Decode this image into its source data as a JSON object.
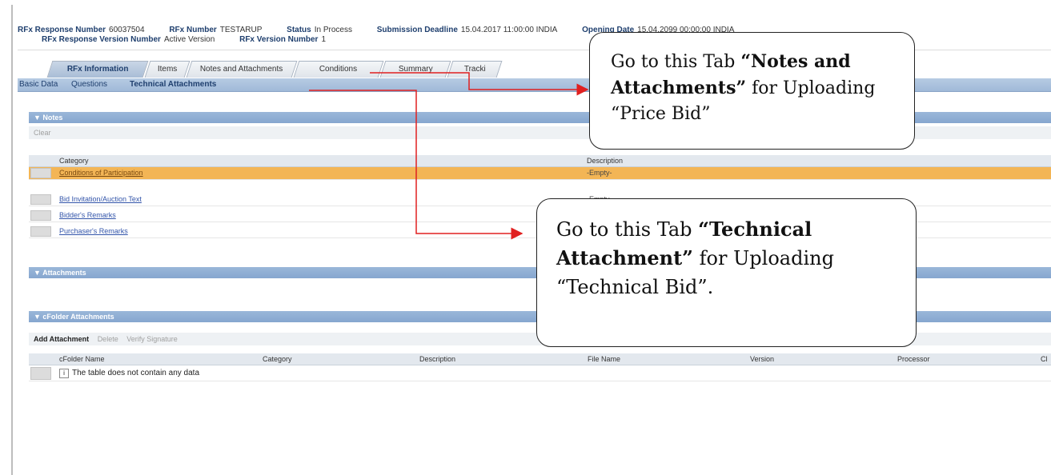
{
  "header": {
    "resp_num_label": "RFx Response Number",
    "resp_num": "60037504",
    "rfx_num_label": "RFx Number",
    "rfx_num": "TESTARUP",
    "status_label": "Status",
    "status": "In Process",
    "deadline_label": "Submission Deadline",
    "deadline": "15.04.2017 11:00:00 INDIA",
    "opening_label": "Opening Date",
    "opening": "15.04.2099 00:00:00 INDIA",
    "resp_ver_label": "RFx Response Version Number",
    "resp_ver": "Active Version",
    "rfx_ver_label": "RFx Version Number",
    "rfx_ver": "1"
  },
  "tabs": [
    "RFx Information",
    "Items",
    "Notes and Attachments",
    "Conditions",
    "Summary",
    "Tracki"
  ],
  "subnav": [
    "Basic Data",
    "Questions",
    "Technical Attachments"
  ],
  "notes": {
    "title": "Notes",
    "clear": "Clear",
    "col_category": "Category",
    "col_description": "Description",
    "rows": [
      {
        "category": "Conditions of Participation",
        "description": "-Empty-"
      },
      {
        "category": "Bid Invitation/Auction Text",
        "description": "-Empty-"
      },
      {
        "category": "Bidder's Remarks",
        "description": ""
      },
      {
        "category": "Purchaser's Remarks",
        "description": ""
      }
    ]
  },
  "attachments": {
    "title": "Attachments"
  },
  "cfolder": {
    "title": "cFolder Attachments",
    "add": "Add Attachment",
    "delete": "Delete",
    "verify": "Verify Signature",
    "columns": [
      "cFolder Name",
      "Category",
      "Description",
      "File Name",
      "Version",
      "Processor",
      "Cl"
    ],
    "empty_text": "The table does not contain any data"
  },
  "callouts": {
    "c1_pre": "Go to this Tab ",
    "c1_bold": "“Notes and Attachments”",
    "c1_post": " for Uploading “Price Bid”",
    "c2_pre": "Go to this Tab ",
    "c2_bold": "“Technical Attachment”",
    "c2_post": " for Uploading “Technical Bid”."
  },
  "colors": {
    "arrow": "#e02020",
    "selected_row": "#f3b555",
    "section_bar": "#8fb0d6"
  }
}
